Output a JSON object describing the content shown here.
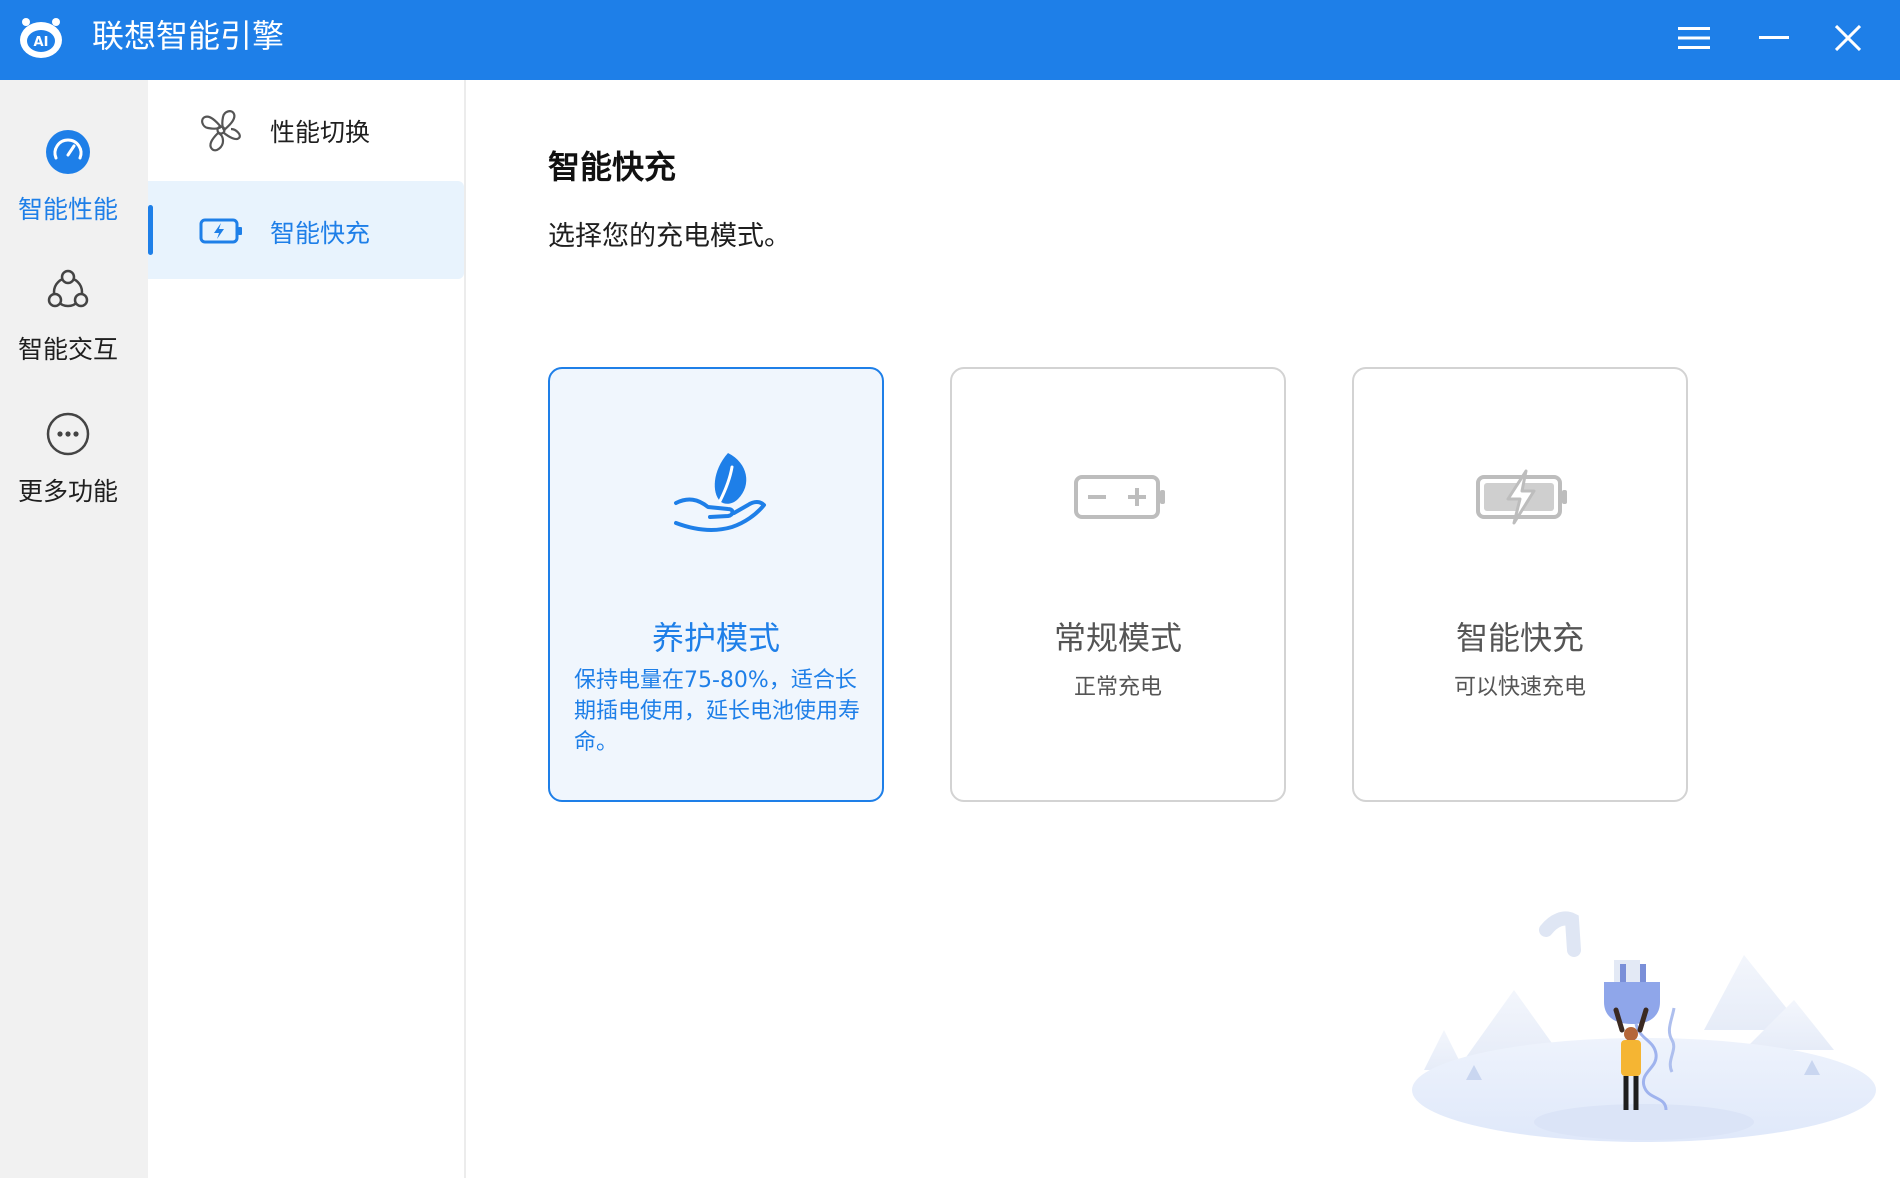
{
  "app": {
    "title": "联想智能引擎"
  },
  "window_controls": {
    "menu": "menu-icon",
    "minimize": "minimize-icon",
    "close": "close-icon"
  },
  "colors": {
    "accent": "#1e7fe8",
    "selected_card_bg": "#f0f6fd",
    "rail_bg": "#f1f1f1"
  },
  "rail": {
    "items": [
      {
        "label": "智能性能",
        "icon": "speedometer-icon",
        "active": true
      },
      {
        "label": "智能交互",
        "icon": "connected-nodes-icon",
        "active": false
      },
      {
        "label": "更多功能",
        "icon": "more-icon",
        "active": false
      }
    ]
  },
  "subnav": {
    "items": [
      {
        "label": "性能切换",
        "icon": "fan-icon",
        "active": false
      },
      {
        "label": "智能快充",
        "icon": "battery-charge-icon",
        "active": true
      }
    ]
  },
  "main": {
    "title": "智能快充",
    "subtitle": "选择您的充电模式。",
    "modes": [
      {
        "title": "养护模式",
        "desc": "保持电量在75-80%，适合长期插电使用，延长电池使用寿命。",
        "icon": "leaf-hand-icon",
        "selected": true
      },
      {
        "title": "常规模式",
        "desc": "正常充电",
        "icon": "battery-icon",
        "selected": false
      },
      {
        "title": "智能快充",
        "desc": "可以快速充电",
        "icon": "fast-charge-battery-icon",
        "selected": false
      }
    ]
  }
}
